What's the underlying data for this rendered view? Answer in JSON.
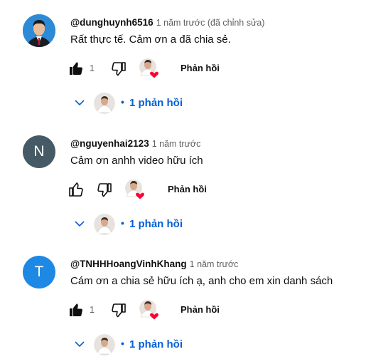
{
  "comments": [
    {
      "handle": "@dunghuynh6516",
      "time": "1 năm trước (đã chỉnh sửa)",
      "text": "Rất thực tế. Cảm ơn a đã chia sẻ.",
      "avatar_letter": "",
      "avatar_color": "#2d8ad6",
      "like_count": "1",
      "liked": true,
      "reply_label": "Phản hồi",
      "replies_label": "1 phản hồi"
    },
    {
      "handle": "@nguyenhai2123",
      "time": "1 năm trước",
      "text": "Cảm ơn anhh video hữu ích",
      "avatar_letter": "N",
      "avatar_color": "#455a64",
      "like_count": "",
      "liked": false,
      "reply_label": "Phản hồi",
      "replies_label": "1 phản hồi"
    },
    {
      "handle": "@TNHHHoangVinhKhang",
      "time": "1 năm trước",
      "text": "Cám ơn a chia sẻ hữu ích ạ, anh cho em xin danh sách",
      "avatar_letter": "T",
      "avatar_color": "#1e88e5",
      "like_count": "1",
      "liked": true,
      "reply_label": "Phản hồi",
      "replies_label": "1 phản hồi"
    }
  ],
  "icons": {
    "like": "thumb-up-icon",
    "dislike": "thumb-down-icon",
    "heart": "creator-heart-icon",
    "expand": "chevron-down-icon"
  },
  "colors": {
    "link": "#065fd4",
    "secondary_text": "#606060",
    "heart": "#ff0033"
  }
}
